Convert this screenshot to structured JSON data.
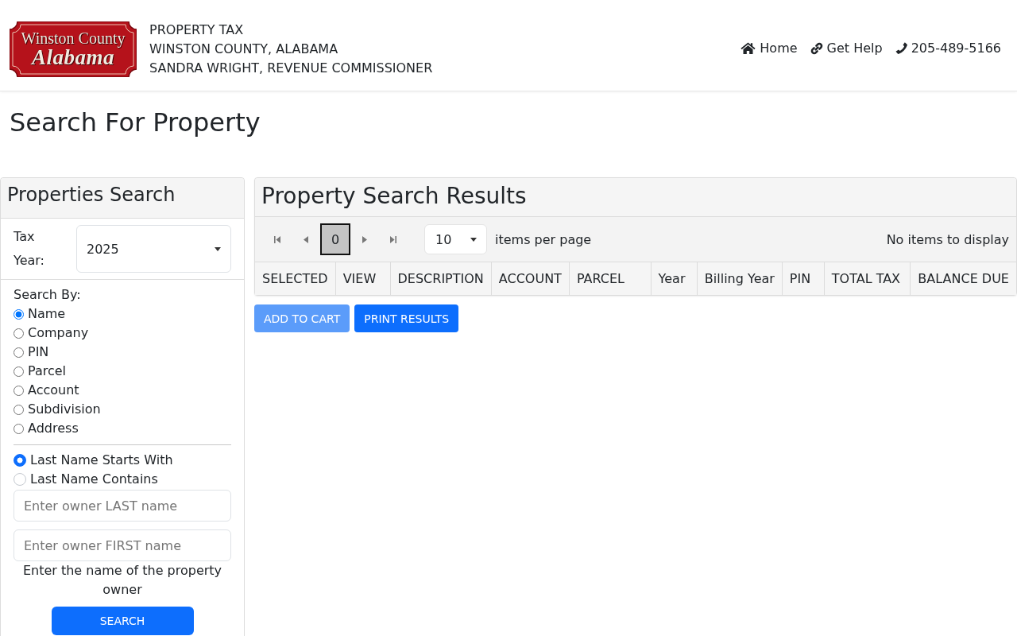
{
  "header": {
    "logo": {
      "line_1": "Winston County",
      "line_2": "Alabama"
    },
    "title_lines": [
      "PROPERTY TAX",
      "WINSTON COUNTY, ALABAMA",
      "SANDRA WRIGHT, REVENUE COMMISSIONER"
    ],
    "nav": [
      {
        "kind": "home",
        "label": "Home"
      },
      {
        "kind": "link",
        "label": "Get Help"
      },
      {
        "kind": "phone",
        "label": "205-489-5166"
      }
    ]
  },
  "page_title": "Search For Property",
  "search_panel": {
    "title": "Properties Search",
    "tax_year": {
      "label": "Tax Year:",
      "value": "2025"
    },
    "search_by": {
      "label": "Search By:",
      "options": [
        {
          "label": "Name",
          "selected": true
        },
        {
          "label": "Company",
          "selected": false
        },
        {
          "label": "PIN",
          "selected": false
        },
        {
          "label": "Parcel",
          "selected": false
        },
        {
          "label": "Account",
          "selected": false
        },
        {
          "label": "Subdivision",
          "selected": false
        },
        {
          "label": "Address",
          "selected": false
        }
      ]
    },
    "name_match": {
      "options": [
        {
          "label": "Last Name Starts With",
          "selected": true
        },
        {
          "label": "Last Name Contains",
          "selected": false
        }
      ]
    },
    "last_name_field": {
      "placeholder": "Enter owner LAST name"
    },
    "first_name_field": {
      "placeholder": "Enter owner FIRST name"
    },
    "help_text": "Enter the name of the property owner",
    "search_button": "SEARCH"
  },
  "results": {
    "title": "Property Search Results",
    "pager": {
      "controls": [
        {
          "kind": "first"
        },
        {
          "kind": "previous"
        },
        {
          "kind": "page",
          "label": "0",
          "selected": true
        },
        {
          "kind": "next"
        },
        {
          "kind": "last"
        }
      ],
      "page_size": "10",
      "page_size_label": "items per page",
      "status": "No items to display"
    },
    "columns": [
      "SELECTED",
      "VIEW",
      "DESCRIPTION",
      "ACCOUNT",
      "PARCEL",
      "Year",
      "Billing Year",
      "PIN",
      "TOTAL TAX",
      "BALANCE DUE"
    ],
    "actions": [
      {
        "label": "ADD TO CART",
        "disabled": true
      },
      {
        "label": "PRINT RESULTS",
        "disabled": false
      }
    ]
  }
}
